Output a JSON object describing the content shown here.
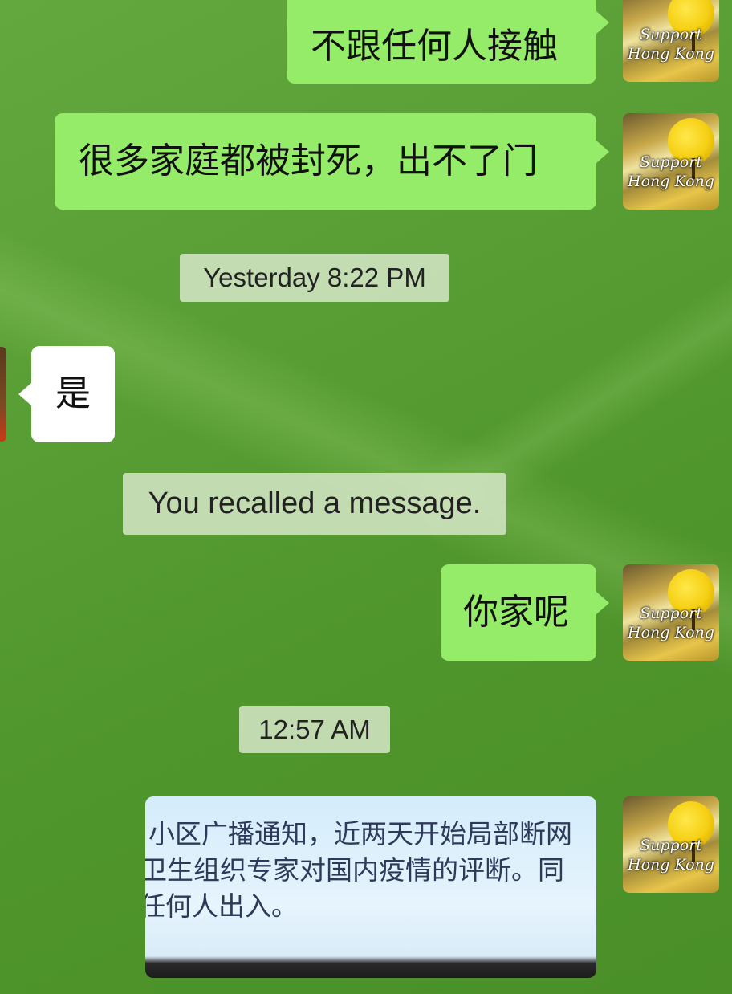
{
  "messages": {
    "m1": "不跟任何人接触",
    "m2": "很多家庭都被封死，出不了门",
    "t1": "Yesterday 8:22 PM",
    "m3": "是",
    "recall": "You recalled a message.",
    "m4": "你家呢",
    "t2": "12:57 AM"
  },
  "avatar": {
    "line1": "Support",
    "line2": "Hong Kong"
  },
  "image_message": {
    "line1": "小区广播通知，近两天开始局部断网",
    "line2": "卫生组织专家对国内疫情的评断。同",
    "line3": "任何人出入。"
  },
  "colors": {
    "outgoing_bubble": "#95ec69",
    "incoming_bubble": "#ffffff",
    "background": "#5a9f36"
  }
}
